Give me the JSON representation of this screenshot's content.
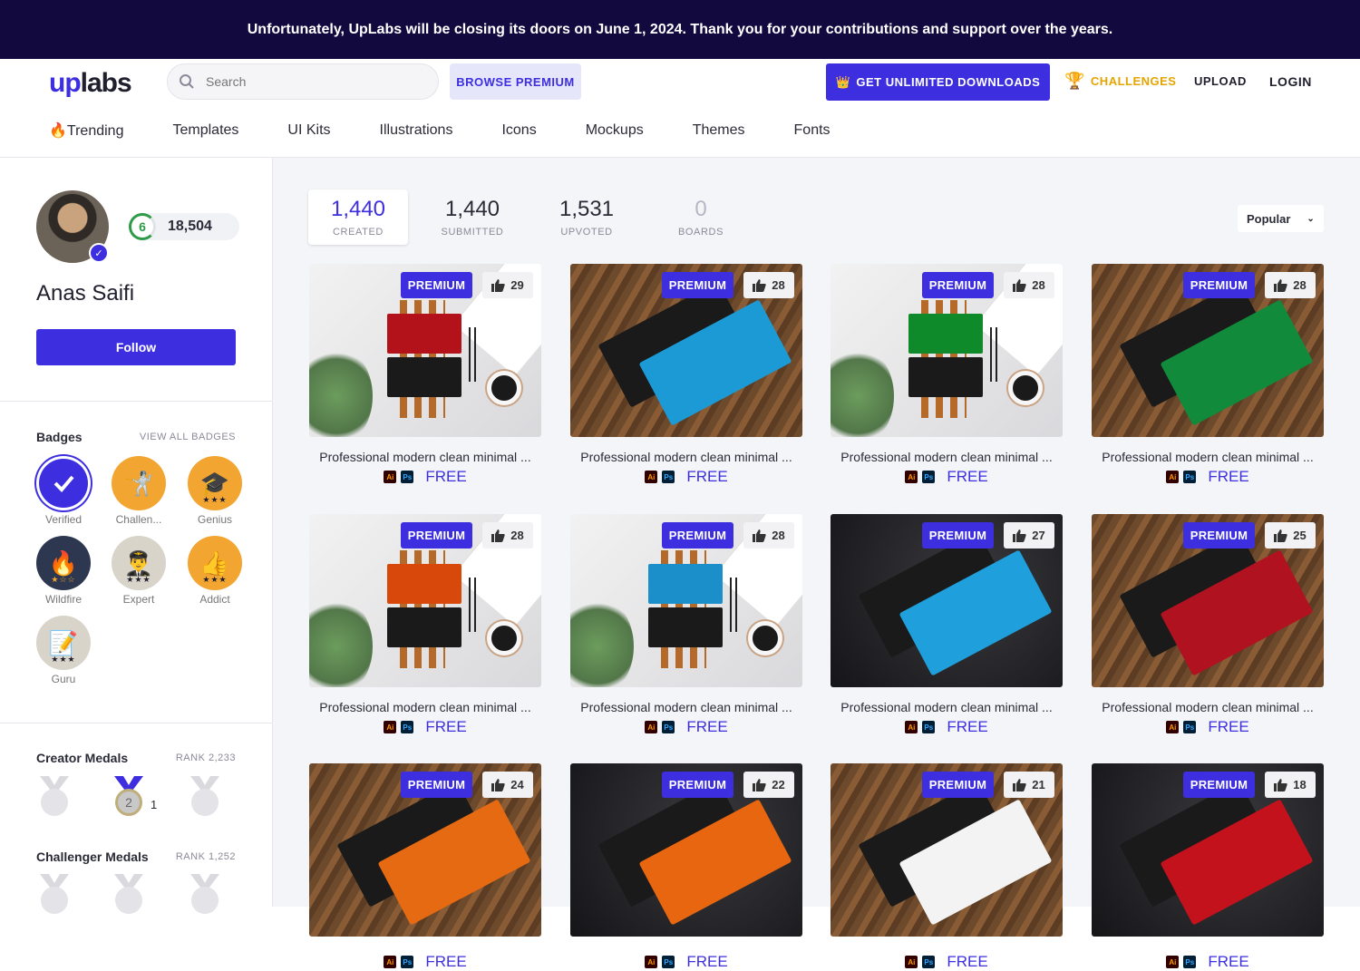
{
  "banner": {
    "text": "Unfortunately, UpLabs will be closing its doors on June 1, 2024. Thank you for your contributions and support over the years."
  },
  "header": {
    "logo_up": "up",
    "logo_labs": "labs",
    "search_placeholder": "Search",
    "browse_premium": "BROWSE PREMIUM",
    "unlimited": "GET UNLIMITED DOWNLOADS",
    "challenges": "CHALLENGES",
    "upload": "UPLOAD",
    "login": "LOGIN"
  },
  "nav": [
    "🔥Trending",
    "Templates",
    "UI Kits",
    "Illustrations",
    "Icons",
    "Mockups",
    "Themes",
    "Fonts"
  ],
  "profile": {
    "level": "6",
    "points": "18,504",
    "name": "Anas Saifi",
    "follow": "Follow"
  },
  "badges": {
    "title": "Badges",
    "link": "VIEW ALL BADGES",
    "items": [
      {
        "label": "Verified",
        "icon": "check-icon",
        "color": "#3d2fe0"
      },
      {
        "label": "Challen...",
        "icon": "challenger-icon",
        "color": "#f2a531"
      },
      {
        "label": "Genius",
        "icon": "graduation-cap-icon",
        "color": "#f2a531"
      },
      {
        "label": "Wildfire",
        "icon": "fire-icon",
        "color": "#2d3850"
      },
      {
        "label": "Expert",
        "icon": "expert-icon",
        "color": "#d8d4c9"
      },
      {
        "label": "Addict",
        "icon": "thumbs-up-icon",
        "color": "#f2a531"
      },
      {
        "label": "Guru",
        "icon": "pencil-icon",
        "color": "#d8d4c9"
      }
    ]
  },
  "creator_medals": {
    "title": "Creator Medals",
    "rank": "RANK 2,233",
    "silver_count": "1"
  },
  "challenger_medals": {
    "title": "Challenger Medals",
    "rank": "RANK 1,252"
  },
  "stats": [
    {
      "value": "1,440",
      "label": "CREATED"
    },
    {
      "value": "1,440",
      "label": "SUBMITTED"
    },
    {
      "value": "1,531",
      "label": "UPVOTED"
    },
    {
      "value": "0",
      "label": "BOARDS"
    }
  ],
  "sort": {
    "value": "Popular"
  },
  "card_common": {
    "premium": "PREMIUM",
    "ai": "Ai",
    "ps": "Ps",
    "free": "FREE"
  },
  "cards": [
    {
      "title": "Professional modern clean minimal ...",
      "likes": "29",
      "scene": "white",
      "color": "#b3121a"
    },
    {
      "title": "Professional modern clean minimal ...",
      "likes": "28",
      "scene": "wood",
      "color": "#1c9ad6"
    },
    {
      "title": "Professional modern clean minimal ...",
      "likes": "28",
      "scene": "white",
      "color": "#0f8a2a"
    },
    {
      "title": "Professional modern clean minimal ...",
      "likes": "28",
      "scene": "wood",
      "color": "#118a3b"
    },
    {
      "title": "Professional modern clean minimal ...",
      "likes": "28",
      "scene": "white",
      "color": "#d9480b"
    },
    {
      "title": "Professional modern clean minimal ...",
      "likes": "28",
      "scene": "white",
      "color": "#1a8fc9"
    },
    {
      "title": "Professional modern clean minimal ...",
      "likes": "27",
      "scene": "dark",
      "color": "#1f9fdb"
    },
    {
      "title": "Professional modern clean minimal ...",
      "likes": "25",
      "scene": "wood",
      "color": "#b0121f"
    },
    {
      "title": "",
      "likes": "24",
      "scene": "wood",
      "color": "#e56a12"
    },
    {
      "title": "",
      "likes": "22",
      "scene": "dark",
      "color": "#e8660f"
    },
    {
      "title": "",
      "likes": "21",
      "scene": "wood",
      "color": "#f3f3f3"
    },
    {
      "title": "",
      "likes": "18",
      "scene": "dark",
      "color": "#c4121d"
    }
  ]
}
